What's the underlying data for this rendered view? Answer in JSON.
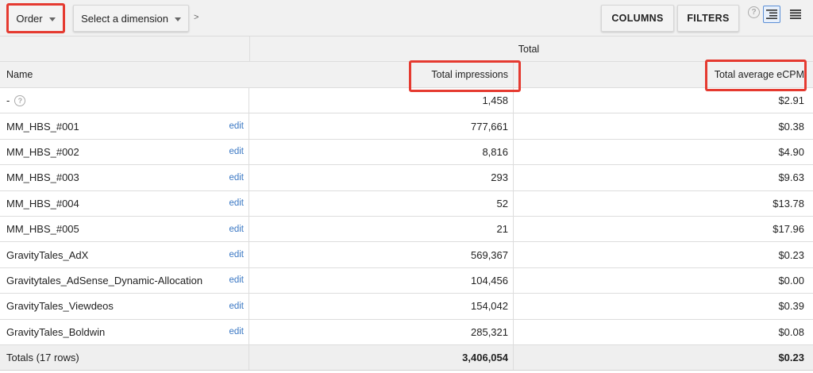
{
  "toolbar": {
    "order_label": "Order",
    "dimension_label": "Select a dimension",
    "separator": ">",
    "columns_label": "COLUMNS",
    "filters_label": "FILTERS",
    "help_glyph": "?"
  },
  "table": {
    "group_header": "Total",
    "name_header": "Name",
    "impressions_header": "Total impressions",
    "ecpm_header": "Total average eCPM",
    "edit_label": "edit",
    "rows": [
      {
        "name": "-",
        "impressions": "1,458",
        "ecpm": "$2.91",
        "has_edit": false
      },
      {
        "name": "MM_HBS_#001",
        "impressions": "777,661",
        "ecpm": "$0.38",
        "has_edit": true
      },
      {
        "name": "MM_HBS_#002",
        "impressions": "8,816",
        "ecpm": "$4.90",
        "has_edit": true
      },
      {
        "name": "MM_HBS_#003",
        "impressions": "293",
        "ecpm": "$9.63",
        "has_edit": true
      },
      {
        "name": "MM_HBS_#004",
        "impressions": "52",
        "ecpm": "$13.78",
        "has_edit": true
      },
      {
        "name": "MM_HBS_#005",
        "impressions": "21",
        "ecpm": "$17.96",
        "has_edit": true
      },
      {
        "name": "GravityTales_AdX",
        "impressions": "569,367",
        "ecpm": "$0.23",
        "has_edit": true
      },
      {
        "name": "Gravitytales_AdSense_Dynamic-Allocation",
        "impressions": "104,456",
        "ecpm": "$0.00",
        "has_edit": true
      },
      {
        "name": "GravityTales_Viewdeos",
        "impressions": "154,042",
        "ecpm": "$0.39",
        "has_edit": true
      },
      {
        "name": "GravityTales_Boldwin",
        "impressions": "285,321",
        "ecpm": "$0.08",
        "has_edit": true
      }
    ],
    "totals": {
      "label": "Totals (17 rows)",
      "impressions": "3,406,054",
      "ecpm": "$0.23"
    }
  },
  "colors": {
    "highlight": "#e53a30",
    "link": "#3b78c4",
    "toolbar_bg": "#f1f1f1"
  }
}
